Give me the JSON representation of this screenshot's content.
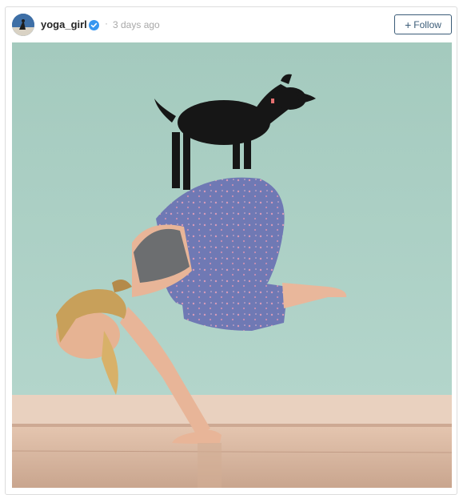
{
  "post": {
    "username": "yoga_girl",
    "dot": "·",
    "time": "3 days ago",
    "follow_plus": "+",
    "follow_label": "Follow"
  },
  "icons": {
    "avatar": "profile-photo",
    "verified": "verified-badge-icon"
  },
  "colors": {
    "verified_blue": "#3897f0",
    "follow_border": "#3b5c78",
    "wall": "#a9cdc2",
    "floor": "#d8b7a0"
  }
}
